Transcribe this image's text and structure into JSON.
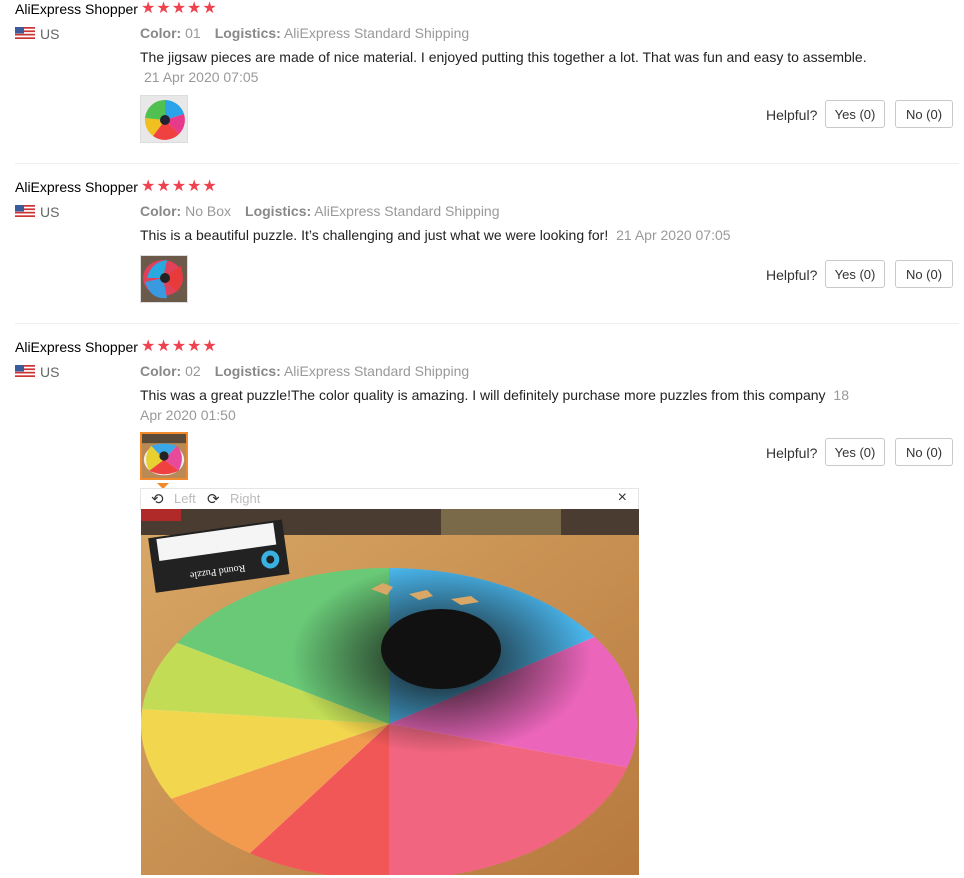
{
  "reviews": [
    {
      "name": "AliExpress Shopper",
      "stars": "★★★★★",
      "country": "US",
      "color_label": "Color:",
      "color": "01",
      "logistics_label": "Logistics:",
      "logistics": "AliExpress Standard Shipping",
      "text": "The jigsaw pieces are made of nice material. I enjoyed putting this together a lot. That was fun and easy to assemble.",
      "date": "21 Apr 2020 07:05",
      "helpful": "Helpful?",
      "yes": "Yes (0)",
      "no": "No (0)"
    },
    {
      "name": "AliExpress Shopper",
      "stars": "★★★★★",
      "country": "US",
      "color_label": "Color:",
      "color": "No Box",
      "logistics_label": "Logistics:",
      "logistics": "AliExpress Standard Shipping",
      "text": "This is a beautiful puzzle. It’s challenging and just what we were looking for!",
      "date": "21 Apr 2020 07:05",
      "helpful": "Helpful?",
      "yes": "Yes (0)",
      "no": "No (0)"
    },
    {
      "name": "AliExpress Shopper",
      "stars": "★★★★★",
      "country": "US",
      "color_label": "Color:",
      "color": "02",
      "logistics_label": "Logistics:",
      "logistics": "AliExpress Standard Shipping",
      "text": "This was a great puzzle!The color quality is amazing. I will definitely purchase more puzzles from this company",
      "date": "18 Apr 2020 01:50",
      "helpful": "Helpful?",
      "yes": "Yes (0)",
      "no": "No (0)"
    }
  ],
  "viewer": {
    "rotate_left": "Left",
    "rotate_right": "Right",
    "close": "×",
    "box_label": "Round Puzzle"
  },
  "colors": {
    "star": "#f0414f",
    "active_thumb": "#f08a2c",
    "muted": "#999999"
  }
}
